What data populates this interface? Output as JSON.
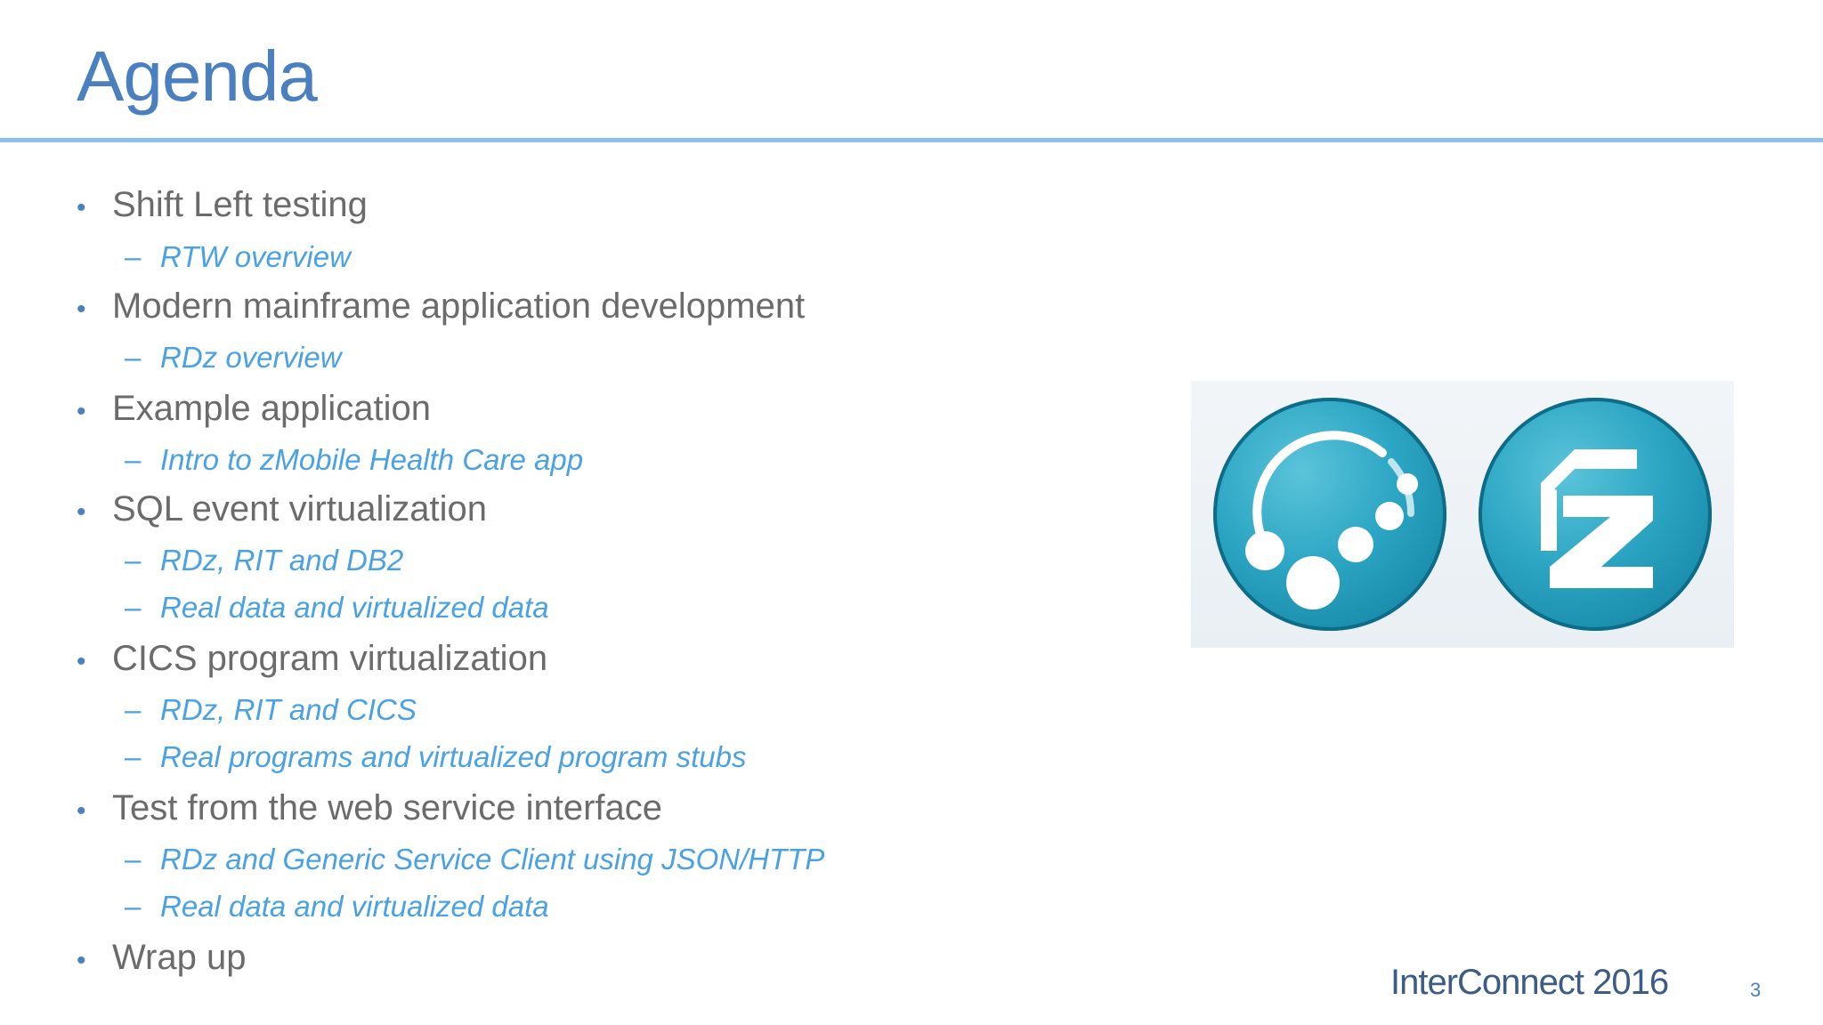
{
  "slide": {
    "title": "Agenda",
    "items": [
      {
        "level": 1,
        "marker": "•",
        "text": "Shift Left testing"
      },
      {
        "level": 2,
        "marker": "–",
        "text": "RTW overview"
      },
      {
        "level": 1,
        "marker": "•",
        "text": "Modern mainframe application development"
      },
      {
        "level": 2,
        "marker": "–",
        "text": "RDz overview"
      },
      {
        "level": 1,
        "marker": "•",
        "text": "Example application"
      },
      {
        "level": 2,
        "marker": "–",
        "text": "Intro to zMobile Health Care app"
      },
      {
        "level": 1,
        "marker": "•",
        "text": "SQL event virtualization"
      },
      {
        "level": 2,
        "marker": "–",
        "text": "RDz, RIT and DB2"
      },
      {
        "level": 2,
        "marker": "–",
        "text": "Real data and virtualized data"
      },
      {
        "level": 1,
        "marker": "•",
        "text": "CICS program virtualization"
      },
      {
        "level": 2,
        "marker": "–",
        "text": "RDz, RIT and CICS"
      },
      {
        "level": 2,
        "marker": "–",
        "text": "Real programs and virtualized program stubs"
      },
      {
        "level": 1,
        "marker": "•",
        "text": "Test from the web service interface"
      },
      {
        "level": 2,
        "marker": "–",
        "text": "RDz  and Generic Service Client using JSON/HTTP"
      },
      {
        "level": 2,
        "marker": "–",
        "text": "Real data and virtualized data"
      },
      {
        "level": 1,
        "marker": "•",
        "text": "Wrap up"
      }
    ],
    "logos": [
      {
        "icon": "rational-integration-tester-icon"
      },
      {
        "icon": "rational-developer-z-icon"
      }
    ],
    "footer": {
      "brand": "InterConnect 2016",
      "page_number": "3"
    },
    "colors": {
      "title": "#4a80bf",
      "rule": "#8cc1ec",
      "level1_text": "#6b6b6b",
      "level2_text": "#4aa1e3",
      "logo_teal": "#2ba5c3"
    }
  }
}
